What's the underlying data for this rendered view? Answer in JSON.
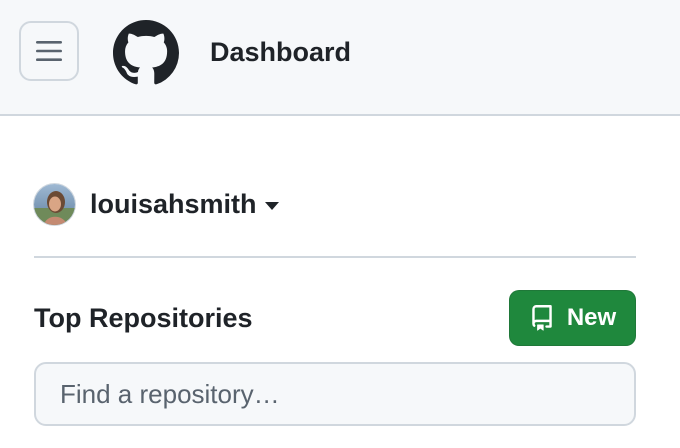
{
  "header": {
    "title": "Dashboard",
    "menu_icon": "hamburger-icon",
    "logo_icon": "github-logo-icon"
  },
  "user": {
    "name": "louisahsmith",
    "avatar_icon": "avatar",
    "dropdown_icon": "caret-down-icon"
  },
  "repositories": {
    "heading": "Top Repositories",
    "new_label": "New",
    "new_icon": "repo-icon",
    "search_placeholder": "Find a repository…",
    "search_value": ""
  },
  "colors": {
    "header_bg": "#f6f8fa",
    "border": "#d0d7de",
    "primary_button": "#1f883d",
    "text": "#1f2328"
  }
}
